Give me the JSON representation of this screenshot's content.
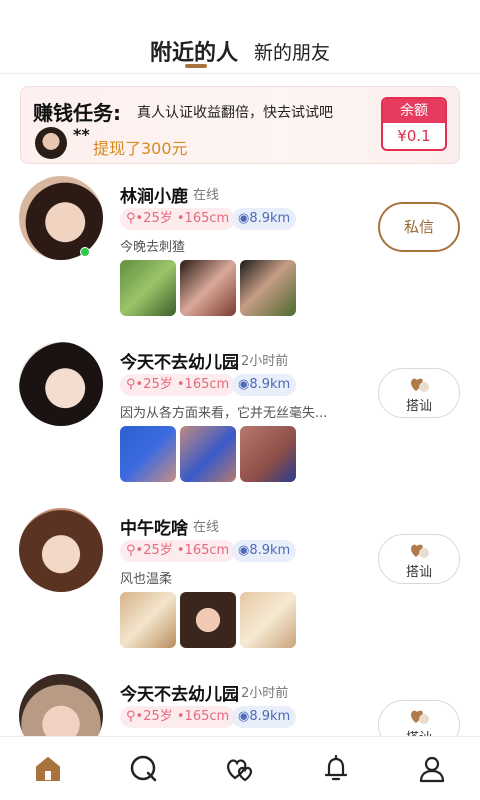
{
  "tabs": {
    "active": "附近的人",
    "other": "新的朋友"
  },
  "task": {
    "title": "赚钱任务:",
    "description": "真人认证收益翻倍，快去试试吧",
    "user": "**",
    "withdraw": "提现了300元",
    "balance_label": "余额",
    "balance_value": "¥0.1"
  },
  "users": [
    {
      "name": "林涧小鹿",
      "status": "在线",
      "age_height": "•25岁 •165cm",
      "distance": "8.9km",
      "bio": "今晚去刺猹",
      "action": "私信",
      "online": true
    },
    {
      "name": "今天不去幼儿园",
      "status": "2小时前",
      "age_height": "•25岁 •165cm",
      "distance": "8.9km",
      "bio": "因为从各方面来看，它并无丝毫失...",
      "action": "搭讪"
    },
    {
      "name": "中午吃啥",
      "status": "在线",
      "age_height": "•25岁 •165cm",
      "distance": "8.9km",
      "bio": "风也温柔",
      "action": "搭讪"
    },
    {
      "name": "今天不去幼儿园",
      "status": "2小时前",
      "age_height": "•25岁 •165cm",
      "distance": "8.9km",
      "bio": "",
      "action": "搭讪"
    }
  ],
  "colors": {
    "accent": "#a9733e",
    "online": "#2ecb4a",
    "balance": "#e63a5e"
  },
  "nav": [
    "home-icon",
    "search-icon",
    "hearts-icon",
    "bell-icon",
    "profile-icon"
  ]
}
